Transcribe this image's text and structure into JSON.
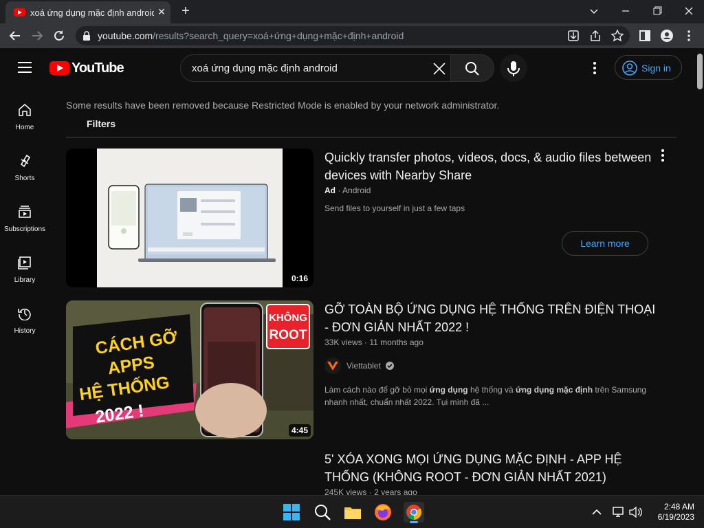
{
  "browser": {
    "tab_title": "xoá ứng dụng mặc định android",
    "url_host": "youtube.com",
    "url_path": "/results?search_query=xoá+ứng+dụng+mặc+định+android"
  },
  "header": {
    "logo_text": "YouTube",
    "search_query": "xoá ứng dụng mặc định android",
    "signin_label": "Sign in"
  },
  "sidebar": {
    "items": [
      {
        "label": "Home",
        "icon": "home-icon"
      },
      {
        "label": "Shorts",
        "icon": "shorts-icon"
      },
      {
        "label": "Subscriptions",
        "icon": "subscriptions-icon"
      },
      {
        "label": "Library",
        "icon": "library-icon"
      },
      {
        "label": "History",
        "icon": "history-icon"
      }
    ]
  },
  "results": {
    "notice": "Some results have been removed because Restricted Mode is enabled by your network administrator.",
    "filters_label": "Filters",
    "ad": {
      "title": "Quickly transfer photos, videos, docs, & audio files between devices with Nearby Share",
      "ad_badge": "Ad",
      "advertiser": "Android",
      "description": "Send files to yourself in just a few taps",
      "cta": "Learn more",
      "duration": "0:16"
    },
    "videos": [
      {
        "title": "GỠ TOÀN BỘ ỨNG DỤNG HỆ THỐNG TRÊN ĐIỆN THOẠI - ĐƠN GIẢN NHẤT 2022 !",
        "views": "33K views",
        "age": "11 months ago",
        "channel": "Viettablet",
        "desc_1": "Làm cách nào để gỡ bỏ mọi ",
        "desc_b1": "ứng dụng",
        "desc_2": " hệ thống và ",
        "desc_b2": "ứng dụng mặc định",
        "desc_3": " trên Samsung nhanh nhất, chuẩn nhất 2022. Tụi mình đã ...",
        "duration": "4:45",
        "thumb_line1": "CÁCH GỠ",
        "thumb_line2": "APPS",
        "thumb_line3": "HỆ THỐNG",
        "thumb_line4": "2022 !",
        "thumb_badge1": "KHÔNG",
        "thumb_badge2": "ROOT"
      },
      {
        "title": "5' XÓA XONG MỌI ỨNG DỤNG MẶC ĐỊNH - APP HỆ THỐNG (KHÔNG ROOT - ĐƠN GIẢN NHẤT 2021)",
        "views": "245K views",
        "age": "2 years ago"
      }
    ]
  },
  "taskbar": {
    "time": "2:48 AM",
    "date": "6/19/2023"
  },
  "colors": {
    "accent_blue": "#3ea6ff",
    "youtube_red": "#ff0000",
    "bg": "#0f0f0f"
  }
}
